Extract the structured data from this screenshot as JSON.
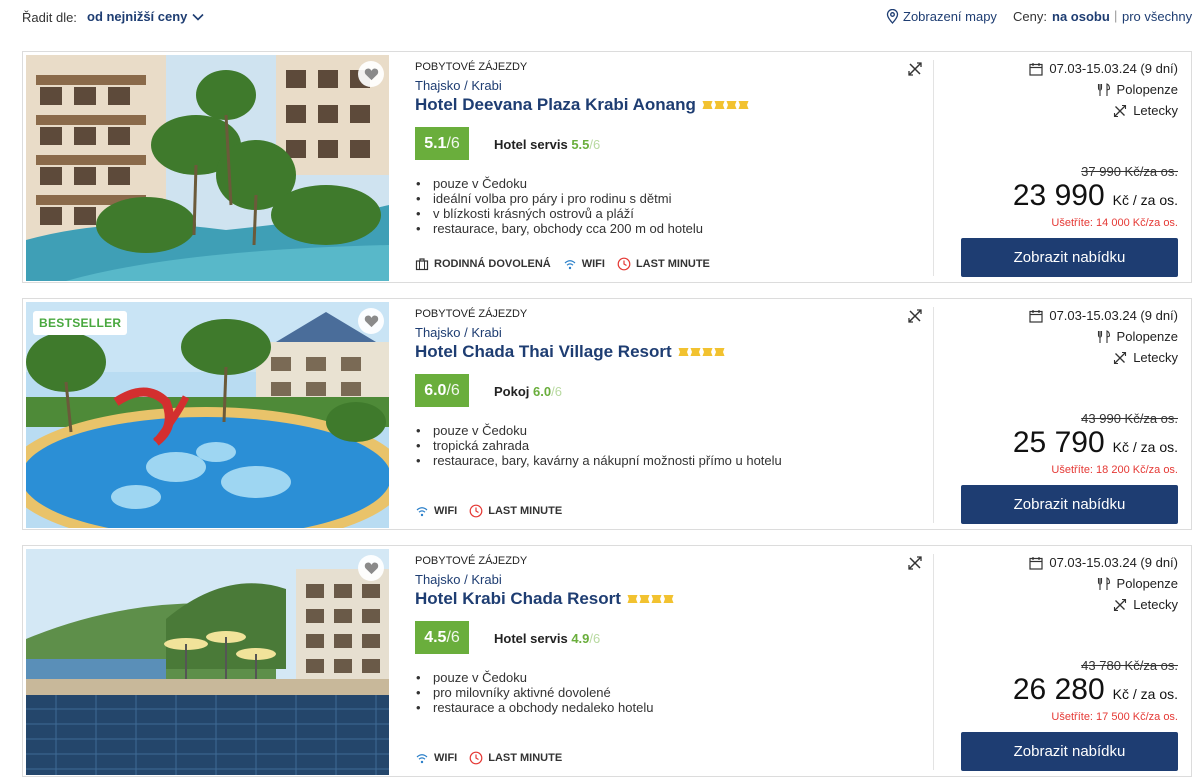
{
  "sort": {
    "label": "Řadit dle:",
    "value": "od nejnižší ceny"
  },
  "map_label": "Zobrazení mapy",
  "prices": {
    "label": "Ceny:",
    "per_person": "na osobu",
    "separator": "|",
    "for_all": "pro všechny"
  },
  "colors": {
    "primary": "#1e3d72",
    "score_green": "#6aae3c",
    "save_red": "#e53935",
    "bestseller_green": "#49a83f",
    "star_gold": "#f2c230"
  },
  "results": [
    {
      "badge": "",
      "category": "POBYTOVÉ ZÁJEZDY",
      "destination": "Thajsko / Krabi",
      "name": "Hotel Deevana Plaza Krabi Aonang",
      "stars": 4,
      "score": "5.1",
      "score_max": "/6",
      "subscore_label": "Hotel servis",
      "subscore_value": "5.5",
      "subscore_max": "/6",
      "bullets": [
        "pouze v Čedoku",
        "ideální volba pro páry i pro rodinu s dětmi",
        "v blízkosti krásných ostrovů a pláží",
        "restaurace, bary, obchody cca 200 m od hotelu"
      ],
      "tags": [
        {
          "icon": "suitcase-icon",
          "label": "RODINNÁ DOVOLENÁ"
        },
        {
          "icon": "wifi-icon",
          "label": "WIFI"
        },
        {
          "icon": "clock-icon",
          "label": "LAST MINUTE"
        }
      ],
      "date": "07.03-15.03.24 (9 dní)",
      "meal": "Polopenze",
      "transport": "Letecky",
      "old_price": "37 990 Kč/za os.",
      "price": "23 990",
      "price_unit": "Kč / za os.",
      "savings": "Ušetříte: 14 000 Kč/za os.",
      "cta": "Zobrazit nabídku"
    },
    {
      "badge": "BESTSELLER",
      "category": "POBYTOVÉ ZÁJEZDY",
      "destination": "Thajsko / Krabi",
      "name": "Hotel Chada Thai Village Resort",
      "stars": 4,
      "score": "6.0",
      "score_max": "/6",
      "subscore_label": "Pokoj",
      "subscore_value": "6.0",
      "subscore_max": "/6",
      "bullets": [
        "pouze v Čedoku",
        "tropická zahrada",
        "restaurace, bary, kavárny a nákupní možnosti přímo u hotelu"
      ],
      "tags": [
        {
          "icon": "wifi-icon",
          "label": "WIFI"
        },
        {
          "icon": "clock-icon",
          "label": "LAST MINUTE"
        }
      ],
      "date": "07.03-15.03.24 (9 dní)",
      "meal": "Polopenze",
      "transport": "Letecky",
      "old_price": "43 990 Kč/za os.",
      "price": "25 790",
      "price_unit": "Kč / za os.",
      "savings": "Ušetříte: 18 200 Kč/za os.",
      "cta": "Zobrazit nabídku"
    },
    {
      "badge": "",
      "category": "POBYTOVÉ ZÁJEZDY",
      "destination": "Thajsko / Krabi",
      "name": "Hotel Krabi Chada Resort",
      "stars": 4,
      "score": "4.5",
      "score_max": "/6",
      "subscore_label": "Hotel servis",
      "subscore_value": "4.9",
      "subscore_max": "/6",
      "bullets": [
        "pouze v Čedoku",
        "pro milovníky aktivné dovolené",
        "restaurace a obchody nedaleko hotelu"
      ],
      "tags": [
        {
          "icon": "wifi-icon",
          "label": "WIFI"
        },
        {
          "icon": "clock-icon",
          "label": "LAST MINUTE"
        }
      ],
      "date": "07.03-15.03.24 (9 dní)",
      "meal": "Polopenze",
      "transport": "Letecky",
      "old_price": "43 780 Kč/za os.",
      "price": "26 280",
      "price_unit": "Kč / za os.",
      "savings": "Ušetříte: 17 500 Kč/za os.",
      "cta": "Zobrazit nabídku"
    }
  ]
}
